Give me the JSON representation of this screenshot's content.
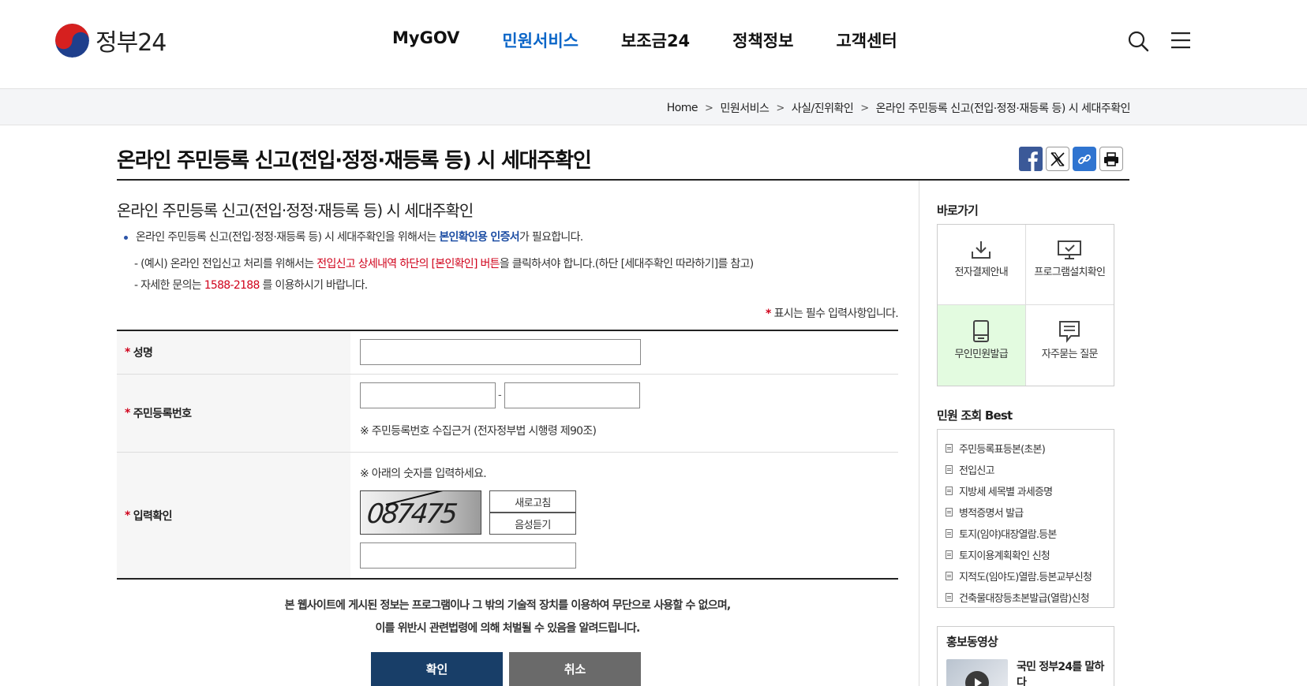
{
  "header": {
    "logo_text": "정부24",
    "nav": [
      "MyGOV",
      "민원서비스",
      "보조금24",
      "정책정보",
      "고객센터"
    ],
    "active_nav": "민원서비스",
    "search_icon": "search-icon",
    "menu_icon": "hamburger-menu-icon"
  },
  "breadcrumb": [
    "Home",
    "민원서비스",
    "사실/진위확인",
    "온라인 주민등록 신고(전입·정정·재등록 등) 시 세대주확인"
  ],
  "page": {
    "title": "온라인 주민등록 신고(전입·정정·재등록 등) 시 세대주확인",
    "subtitle": "온라인 주민등록 신고(전입·정정·재등록 등) 시 세대주확인",
    "notice1_pre": "온라인 주민등록 신고(전입·정정·재등록 등) 시 세대주확인을 위해서는 ",
    "notice1_em": "본인확인용 인증서",
    "notice1_post": "가 필요합니다.",
    "notice2_pre": "- (예시) 온라인 전입신고 처리를 위해서는 ",
    "notice2_em": "전입신고 상세내역 하단의 [본인확인] 버튼",
    "notice2_post": "을 클릭하셔야 합니다.(하단 [세대주확인 따라하기]를 참고)",
    "notice3_pre": "- 자세한 문의는 ",
    "notice3_em": "1588-2188",
    "notice3_post": " 를 이용하시기 바랍니다.",
    "required_note": "표시는 필수 입력사항입니다."
  },
  "share": {
    "facebook_icon": "facebook-icon",
    "x_icon": "x-twitter-icon",
    "link_icon": "link-copy-icon",
    "print_icon": "print-icon"
  },
  "form": {
    "name_label": "성명",
    "name_value": "",
    "rrn_label": "주민등록번호",
    "rrn_front": "",
    "rrn_back": "",
    "rrn_dash": "-",
    "rrn_hint": "※ 주민등록번호 수집근거 (전자정부법 시행령 제90조)",
    "captcha_label": "입력확인",
    "captcha_hint": "※ 아래의 숫자를 입력하세요.",
    "captcha_digits": "087475",
    "refresh_label": "새로고침",
    "audio_label": "음성듣기",
    "captcha_value": ""
  },
  "legal": {
    "line1": "본 웹사이트에 게시된 정보는 프로그램이나 그 밖의 기술적 장치를 이용하여 무단으로 사용할 수 없으며,",
    "line2": "이를 위반시 관련법령에 의해 처벌될 수 있음을 알려드립니다."
  },
  "buttons": {
    "ok": "확인",
    "cancel": "취소"
  },
  "sidebar": {
    "quick_title": "바로가기",
    "quick": [
      {
        "label": "전자결제안내",
        "icon": "download-tray-icon"
      },
      {
        "label": "프로그램설치확인",
        "icon": "monitor-check-icon"
      },
      {
        "label": "무인민원발급",
        "icon": "kiosk-icon"
      },
      {
        "label": "자주묻는 질문",
        "icon": "speech-bubble-icon"
      }
    ],
    "best_title": "민원 조회 Best",
    "best": [
      "주민등록표등본(초본)",
      "전입신고",
      "지방세 세목별 과세증명",
      "병적증명서 발급",
      "토지(임야)대장열람.등본",
      "토지이용계획확인 신청",
      "지적도(임야도)열람.등본교부신청",
      "건축물대장등초본발급(열람)신청"
    ],
    "promo_title": "홍보동영상",
    "promo_item": "국민 정부24를 말하다"
  }
}
